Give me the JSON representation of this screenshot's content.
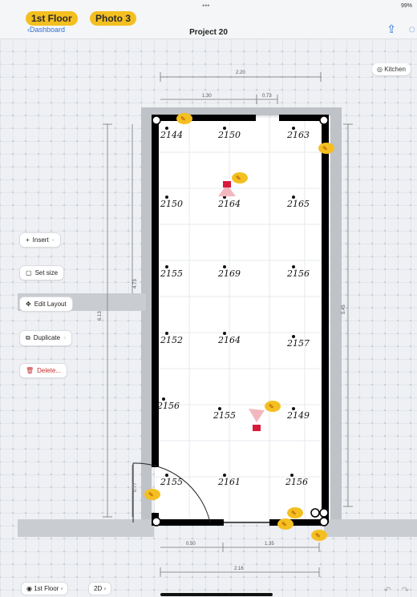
{
  "header": {
    "floor_pill": "1st Floor",
    "photo_pill": "Photo 3",
    "back_label": "Dashboard",
    "title": "Project 20",
    "status_time": "9:41",
    "status_right": "99%"
  },
  "toolbar_right": {
    "kitchen_label": "Kitchen"
  },
  "side_menu": {
    "insert": "Insert",
    "set_size": "Set size",
    "edit_layout": "Edit Layout",
    "duplicate": "Duplicate",
    "delete": "Delete..."
  },
  "dimensions": {
    "top_total": "2.20",
    "top_left": "1.30",
    "top_right": "0.73",
    "left_total": "6.13",
    "left_upper": "4.73",
    "left_lower": "0.77",
    "right_total": "5.45",
    "bottom_left": "0.50",
    "bottom_right": "1.35",
    "bottom_total": "2.16"
  },
  "points": [
    {
      "id": "p1",
      "label": "2144"
    },
    {
      "id": "p2",
      "label": "2150"
    },
    {
      "id": "p3",
      "label": "2163"
    },
    {
      "id": "p4",
      "label": "2150"
    },
    {
      "id": "p5",
      "label": "2164"
    },
    {
      "id": "p6",
      "label": "2165"
    },
    {
      "id": "p7",
      "label": "2155"
    },
    {
      "id": "p8",
      "label": "2169"
    },
    {
      "id": "p9",
      "label": "2156"
    },
    {
      "id": "p10",
      "label": "2152"
    },
    {
      "id": "p11",
      "label": "2164"
    },
    {
      "id": "p12",
      "label": "2157"
    },
    {
      "id": "p13",
      "label": "2156"
    },
    {
      "id": "p14",
      "label": "2155"
    },
    {
      "id": "p15",
      "label": "2149"
    },
    {
      "id": "p16",
      "label": "2155"
    },
    {
      "id": "p17",
      "label": "2161"
    },
    {
      "id": "p18",
      "label": "2156"
    }
  ],
  "bottom": {
    "floor_label": "1st Floor",
    "view_label": "2D"
  },
  "colors": {
    "accent": "#f4bf20",
    "link": "#2f6fd6",
    "wall": "#000000",
    "danger": "#c62828"
  }
}
